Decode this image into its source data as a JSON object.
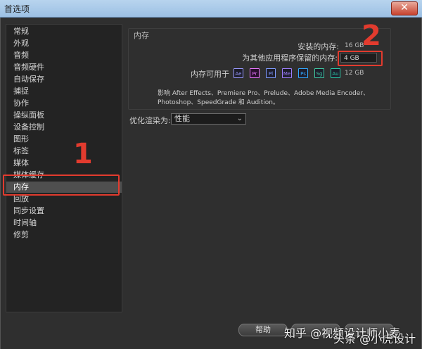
{
  "window": {
    "title": "首选项",
    "close_glyph": "✕"
  },
  "sidebar": {
    "items": [
      {
        "label": "常规"
      },
      {
        "label": "外观"
      },
      {
        "label": "音频"
      },
      {
        "label": "音频硬件"
      },
      {
        "label": "自动保存"
      },
      {
        "label": "捕捉"
      },
      {
        "label": "协作"
      },
      {
        "label": "操纵面板"
      },
      {
        "label": "设备控制"
      },
      {
        "label": "图形"
      },
      {
        "label": "标签"
      },
      {
        "label": "媒体"
      },
      {
        "label": "媒体缓存"
      },
      {
        "label": "内存"
      },
      {
        "label": "回放"
      },
      {
        "label": "同步设置"
      },
      {
        "label": "时间轴"
      },
      {
        "label": "修剪"
      }
    ],
    "selected": "内存"
  },
  "memory": {
    "section_title": "内存",
    "installed_label": "安装的内存:",
    "installed_value": "16 GB",
    "reserved_label": "为其他应用程序保留的内存:",
    "reserved_value": "4 GB",
    "available_label": "内存可用于",
    "available_value": "12 GB",
    "apps": [
      {
        "abbr": "Ae",
        "color": "#9999ff"
      },
      {
        "abbr": "Pr",
        "color": "#ea77ff"
      },
      {
        "abbr": "Pl",
        "color": "#7f9cff"
      },
      {
        "abbr": "Me",
        "color": "#9f7fff"
      },
      {
        "abbr": "Ps",
        "color": "#31a8ff"
      },
      {
        "abbr": "Sg",
        "color": "#3fc7a0"
      },
      {
        "abbr": "Au",
        "color": "#28c9a8"
      }
    ],
    "affects_text": "影响 After Effects、Premiere Pro、Prelude、Adobe Media Encoder、Photoshop、SpeedGrade 和 Audition。"
  },
  "optimize": {
    "label": "优化渲染为:",
    "selected": "性能",
    "chevron_glyph": "⌄"
  },
  "buttons": {
    "help": "帮助"
  },
  "annotations": {
    "one": "1",
    "two": "2",
    "color": "#e23b2e"
  },
  "watermarks": {
    "zhihu": "知乎 @视频设计师小麦",
    "toutiao": "头条 @小虎设计"
  }
}
